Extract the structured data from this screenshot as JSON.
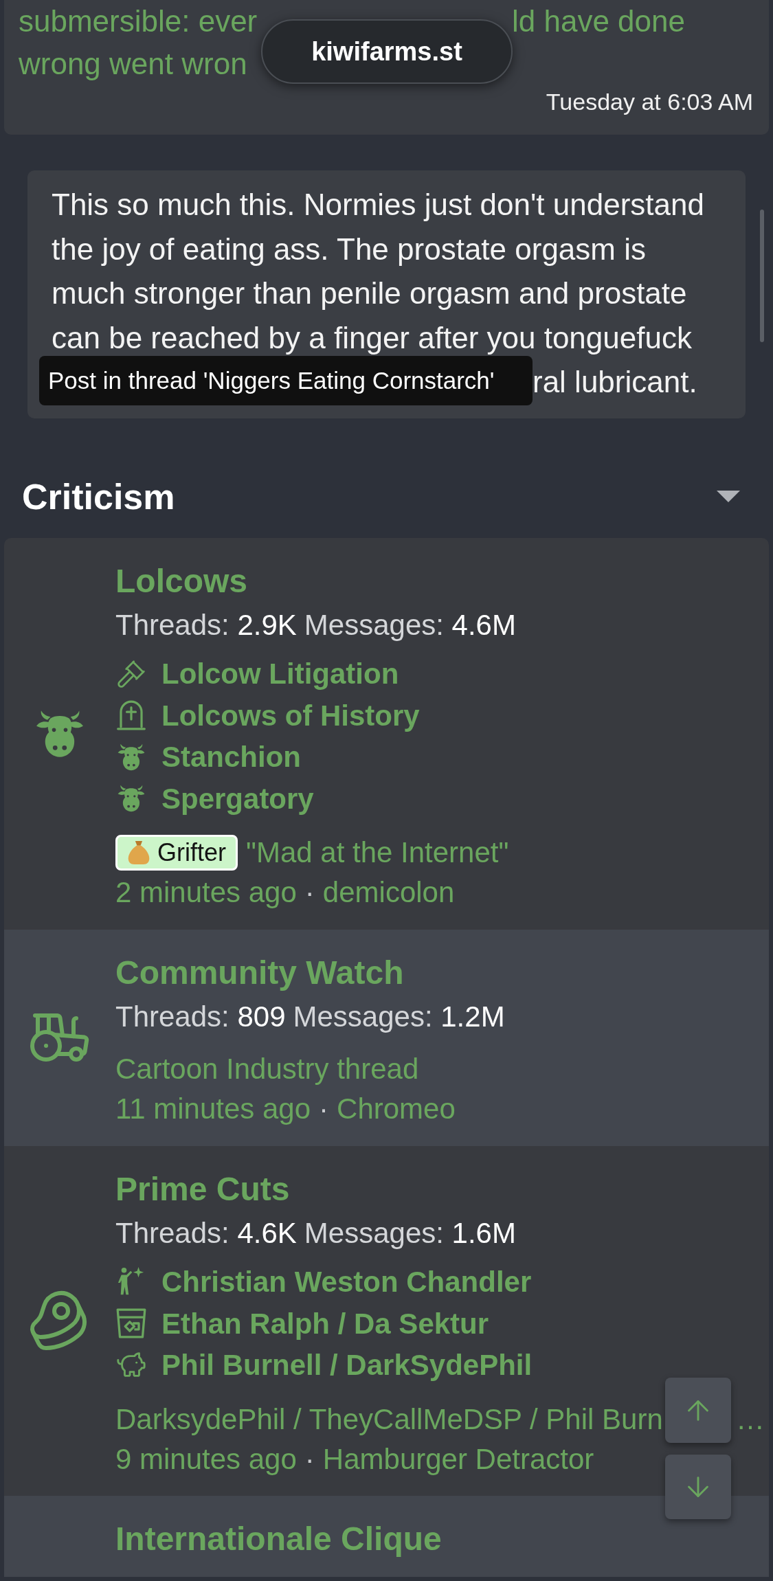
{
  "previous_post": {
    "title_lines": [
      [
        "submersible: ever",
        "ld have done"
      ],
      [
        "wrong went wron"
      ]
    ],
    "date": "Tuesday at 6:03 AM"
  },
  "address_pill": {
    "text": "kiwifarms.st"
  },
  "profile_post": {
    "body": "This so much this. Normies just don't understand the joy of eating ass. The prostate orgasm is much stronger than penile orgasm and prostate can be reached by a finger after you tonguefuck",
    "body_tail": "ral lubricant.",
    "tooltip": "Post in thread 'Niggers Eating Cornstarch'"
  },
  "category": {
    "title": "Criticism",
    "expanded": true,
    "forums": [
      {
        "title": "Lolcows",
        "stats": [
          {
            "label": "Threads:",
            "value": "2.9K"
          },
          {
            "label": "Messages:",
            "value": "4.6M"
          }
        ],
        "subforums": [
          "Lolcow Litigation",
          "Lolcows of History",
          "Stanchion",
          "Spergatory"
        ],
        "last_post": {
          "prefix": "Grifter",
          "title": "\"Mad at the Internet\"",
          "time": "2 minutes ago",
          "separator": "·",
          "user": "demicolon"
        }
      },
      {
        "title": "Community Watch",
        "stats": [
          {
            "label": "Threads:",
            "value": "809"
          },
          {
            "label": "Messages:",
            "value": "1.2M"
          }
        ],
        "last_post": {
          "title": "Cartoon Industry thread",
          "time": "11 minutes ago",
          "separator": "·",
          "user": "Chromeo"
        }
      },
      {
        "title": "Prime Cuts",
        "stats": [
          {
            "label": "Threads:",
            "value": "4.6K"
          },
          {
            "label": "Messages:",
            "value": "1.6M"
          }
        ],
        "subforums": [
          "Christian Weston Chandler",
          "Ethan Ralph / Da Sektur",
          "Phil Burnell / DarkSydePhil"
        ],
        "last_post": {
          "title": "DarksydePhil / TheyCallMeDSP / Phil Burn",
          "title_end": "…",
          "time": "9 minutes ago",
          "separator": "·",
          "user": "Hamburger Detractor"
        }
      },
      {
        "title": "Internationale Clique"
      }
    ]
  }
}
